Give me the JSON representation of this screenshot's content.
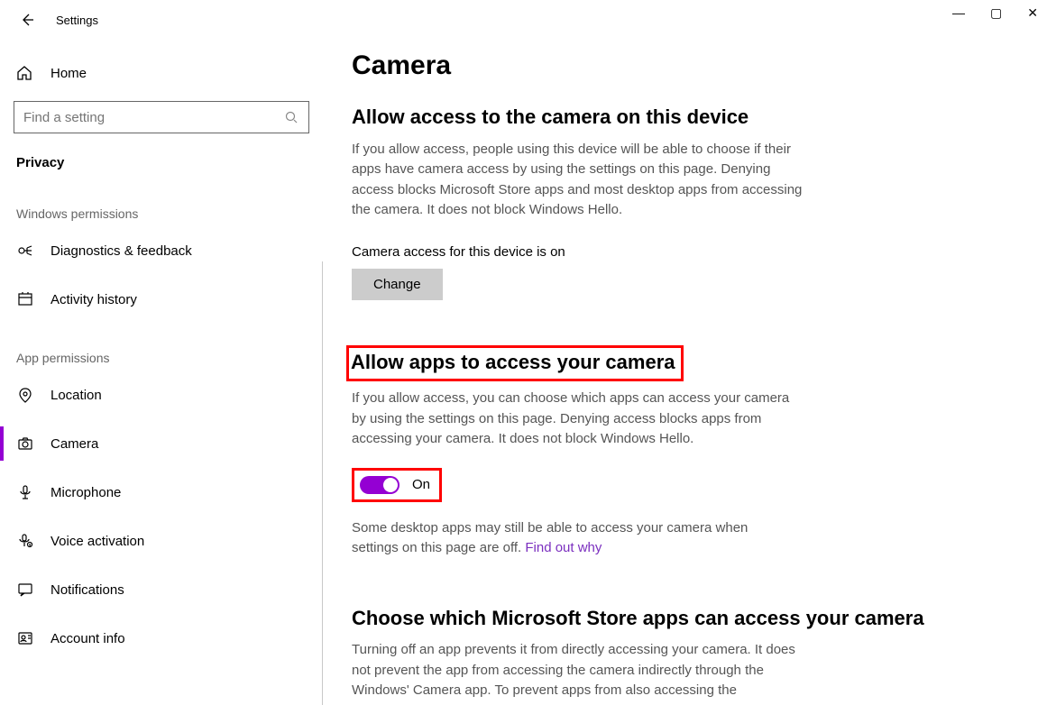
{
  "app_title": "Settings",
  "home_label": "Home",
  "search_placeholder": "Find a setting",
  "category_label": "Privacy",
  "group_windows_label": "Windows permissions",
  "group_app_label": "App permissions",
  "nav": {
    "diagnostics": "Diagnostics & feedback",
    "activity": "Activity history",
    "location": "Location",
    "camera": "Camera",
    "microphone": "Microphone",
    "voice": "Voice activation",
    "notifications": "Notifications",
    "account": "Account info"
  },
  "page": {
    "title": "Camera",
    "sec1_title": "Allow access to the camera on this device",
    "sec1_desc": "If you allow access, people using this device will be able to choose if their apps have camera access by using the settings on this page. Denying access blocks Microsoft Store apps and most desktop apps from accessing the camera. It does not block Windows Hello.",
    "sec1_status": "Camera access for this device is on",
    "change_btn": "Change",
    "sec2_title": "Allow apps to access your camera",
    "sec2_desc": "If you allow access, you can choose which apps can access your camera by using the settings on this page. Denying access blocks apps from accessing your camera. It does not block Windows Hello.",
    "toggle_label": "On",
    "desktop_note_a": "Some desktop apps may still be able to access your camera when settings on this page are off. ",
    "desktop_note_link": "Find out why",
    "sec3_title": "Choose which Microsoft Store apps can access your camera",
    "sec3_desc": "Turning off an app prevents it from directly accessing your camera. It does not prevent the app from accessing the camera indirectly through the Windows' Camera app. To prevent apps from also accessing the"
  },
  "win_controls": {
    "min": "—",
    "max": "▢",
    "close": "✕"
  }
}
